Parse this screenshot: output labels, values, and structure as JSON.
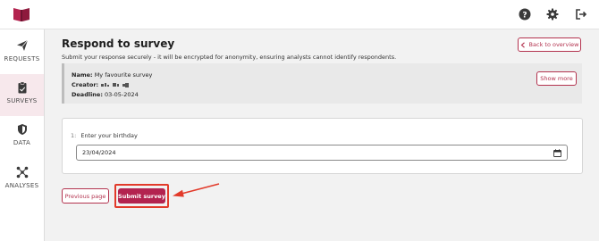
{
  "topbar": {
    "logo_icon": "book-logo",
    "help_icon": "help-icon",
    "settings_icon": "gear-icon",
    "logout_icon": "logout-icon",
    "accent_color": "#b3234f"
  },
  "sidebar": {
    "items": [
      {
        "label": "REQUESTS",
        "icon": "paper-plane-icon",
        "active": false
      },
      {
        "label": "SURVEYS",
        "icon": "clipboard-icon",
        "active": true
      },
      {
        "label": "DATA",
        "icon": "shield-icon",
        "active": false
      },
      {
        "label": "ANALYSES",
        "icon": "network-icon",
        "active": false
      }
    ]
  },
  "page": {
    "title": "Respond to survey",
    "subtitle": "Submit your response securely - it will be encrypted for anonymity, ensuring analysts cannot identify respondents.",
    "back_label": "Back to overview"
  },
  "info": {
    "name_label": "Name:",
    "name_value": "My favourite survey",
    "creator_label": "Creator:",
    "deadline_label": "Deadline:",
    "deadline_value": "03-05-2024",
    "show_more_label": "Show more"
  },
  "question": {
    "number": "1:",
    "label": "Enter your birthday",
    "value": "23/04/2024"
  },
  "actions": {
    "previous_label": "Previous page",
    "submit_label": "Submit survey"
  }
}
